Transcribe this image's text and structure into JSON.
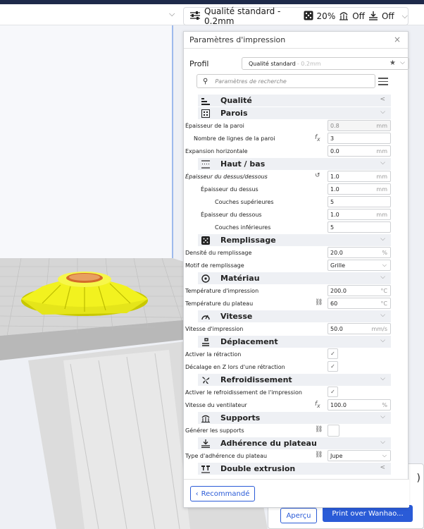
{
  "header": {
    "profile_summary": "Qualité standard - 0.2mm",
    "infill": "20%",
    "support": "Off",
    "adhesion": "Off"
  },
  "panel": {
    "title": "Paramètres d'impression",
    "profile_label": "Profil",
    "profile_value": "Qualité standard",
    "profile_suffix": " - 0.2mm",
    "search_placeholder": "Paramètres de recherche",
    "recommended_button": "Recommandé"
  },
  "categories": {
    "quality": "Qualité",
    "walls": "Parois",
    "topbottom": "Haut / bas",
    "infill": "Remplissage",
    "material": "Matériau",
    "speed": "Vitesse",
    "travel": "Déplacement",
    "cooling": "Refroidissement",
    "supports": "Supports",
    "adhesion": "Adhérence du plateau",
    "dual": "Double extrusion"
  },
  "settings": {
    "wall_thickness": {
      "label": "Épaisseur de la paroi",
      "value": "0.8",
      "unit": "mm"
    },
    "wall_line_count": {
      "label": "Nombre de lignes de la paroi",
      "value": "3"
    },
    "horizontal_expansion": {
      "label": "Expansion horizontale",
      "value": "0.0",
      "unit": "mm"
    },
    "top_bottom_thickness": {
      "label": "Épaisseur du dessus/dessous",
      "value": "1.0",
      "unit": "mm"
    },
    "top_thickness": {
      "label": "Épaisseur du dessus",
      "value": "1.0",
      "unit": "mm"
    },
    "top_layers": {
      "label": "Couches supérieures",
      "value": "5"
    },
    "bottom_thickness": {
      "label": "Épaisseur du dessous",
      "value": "1.0",
      "unit": "mm"
    },
    "bottom_layers": {
      "label": "Couches inférieures",
      "value": "5"
    },
    "infill_density": {
      "label": "Densité du remplissage",
      "value": "20.0",
      "unit": "%"
    },
    "infill_pattern": {
      "label": "Motif de remplissage",
      "value": "Grille"
    },
    "print_temp": {
      "label": "Température d'impression",
      "value": "200.0",
      "unit": "°C"
    },
    "bed_temp": {
      "label": "Température du plateau",
      "value": "60",
      "unit": "°C"
    },
    "print_speed": {
      "label": "Vitesse d'impression",
      "value": "50.0",
      "unit": "mm/s"
    },
    "retraction": {
      "label": "Activer la rétraction"
    },
    "z_hop": {
      "label": "Décalage en Z lors d'une rétraction"
    },
    "cooling": {
      "label": "Activer le refroidissement de l'impression"
    },
    "fan_speed": {
      "label": "Vitesse du ventilateur",
      "value": "100.0",
      "unit": "%"
    },
    "gen_supports": {
      "label": "Générer les supports"
    },
    "adhesion_type": {
      "label": "Type d'adhérence du plateau",
      "value": "Jupe"
    }
  },
  "bottom": {
    "preview_button": "Aperçu",
    "print_button": "Print over Wanhao..."
  },
  "colors": {
    "accent": "#2a5bd7",
    "model": "#f2f21f",
    "build_plate": "#d9d9d9"
  }
}
